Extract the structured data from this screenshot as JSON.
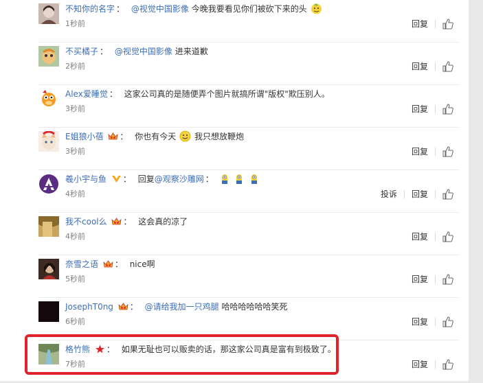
{
  "reply_label": "回复",
  "report_label": "投诉",
  "comments": [
    {
      "user": "不知你的名字",
      "mention": "@视觉中国影像",
      "text": "今晚我要看见你们被砍下来的头",
      "time": "1秒前"
    },
    {
      "user": "不买橘子",
      "mention": "@视觉中国影像",
      "text": "进来道歉",
      "time": "2秒前"
    },
    {
      "user": "Alex爱睡觉",
      "mention": "",
      "text": "这家公司真的是随便弄个图片就搞所谓\"版权\"欺压别人。",
      "time": "3秒前"
    },
    {
      "user": "E姐狼小蓓",
      "mention": "",
      "text": "你也有今天",
      "text2": "我只想放鞭炮",
      "time": "3秒前"
    },
    {
      "user": "羲小宇与鱼",
      "mention": "",
      "text": "回复",
      "mention2": "@观察沙雕网",
      "time": "4秒前"
    },
    {
      "user": "我不cool么",
      "mention": "",
      "text": "这会真的凉了",
      "time": "4秒前"
    },
    {
      "user": "奈雪之语",
      "mention": "",
      "text": "nice啊",
      "time": "5秒前"
    },
    {
      "user": "JosephT0ng",
      "mention": "@请给我加一只鸡腿",
      "text": "哈哈哈哈哈哈笑死",
      "time": "6秒前"
    },
    {
      "user": "格竹熊",
      "mention": "",
      "text": "如果无耻也可以贩卖的话，那这家公司真是富有到极致了。",
      "time": "7秒前"
    }
  ],
  "colors": {
    "link": "#3c6eb5",
    "highlight": "#e0232b",
    "time": "#808080"
  }
}
